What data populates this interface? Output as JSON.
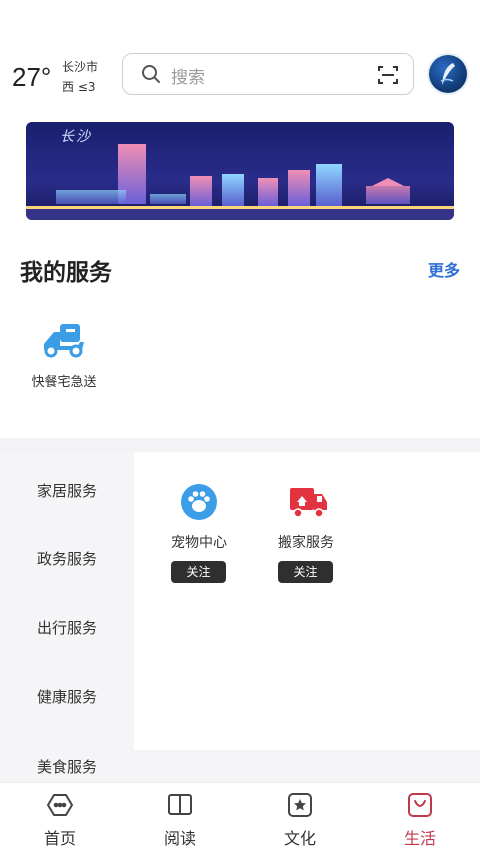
{
  "header": {
    "temperature": "27°",
    "city": "长沙市",
    "wind": "西 ≤3",
    "search_placeholder": "搜索",
    "icons": {
      "search": "search-icon",
      "scan": "scan-icon",
      "avatar": "avatar"
    }
  },
  "banner": {
    "title": "长沙"
  },
  "my_services": {
    "title": "我的服务",
    "more": "更多",
    "items": [
      {
        "label": "快餐宅急送",
        "icon": "scooter-icon"
      }
    ]
  },
  "categories": {
    "items": [
      {
        "label": "家居服务"
      },
      {
        "label": "政务服务"
      },
      {
        "label": "出行服务"
      },
      {
        "label": "健康服务"
      },
      {
        "label": "美食服务"
      }
    ],
    "selected": "家居服务",
    "services": [
      {
        "label": "宠物中心",
        "follow": "关注",
        "icon": "paw-icon",
        "color": "#3a9de6"
      },
      {
        "label": "搬家服务",
        "follow": "关注",
        "icon": "moving-truck-icon",
        "color": "#e2333f"
      }
    ]
  },
  "tabbar": {
    "tabs": [
      {
        "label": "首页",
        "icon": "home-icon"
      },
      {
        "label": "阅读",
        "icon": "book-icon"
      },
      {
        "label": "文化",
        "icon": "star-icon"
      },
      {
        "label": "生活",
        "icon": "bag-icon"
      }
    ],
    "active": "生活",
    "active_color": "#c0394b"
  }
}
